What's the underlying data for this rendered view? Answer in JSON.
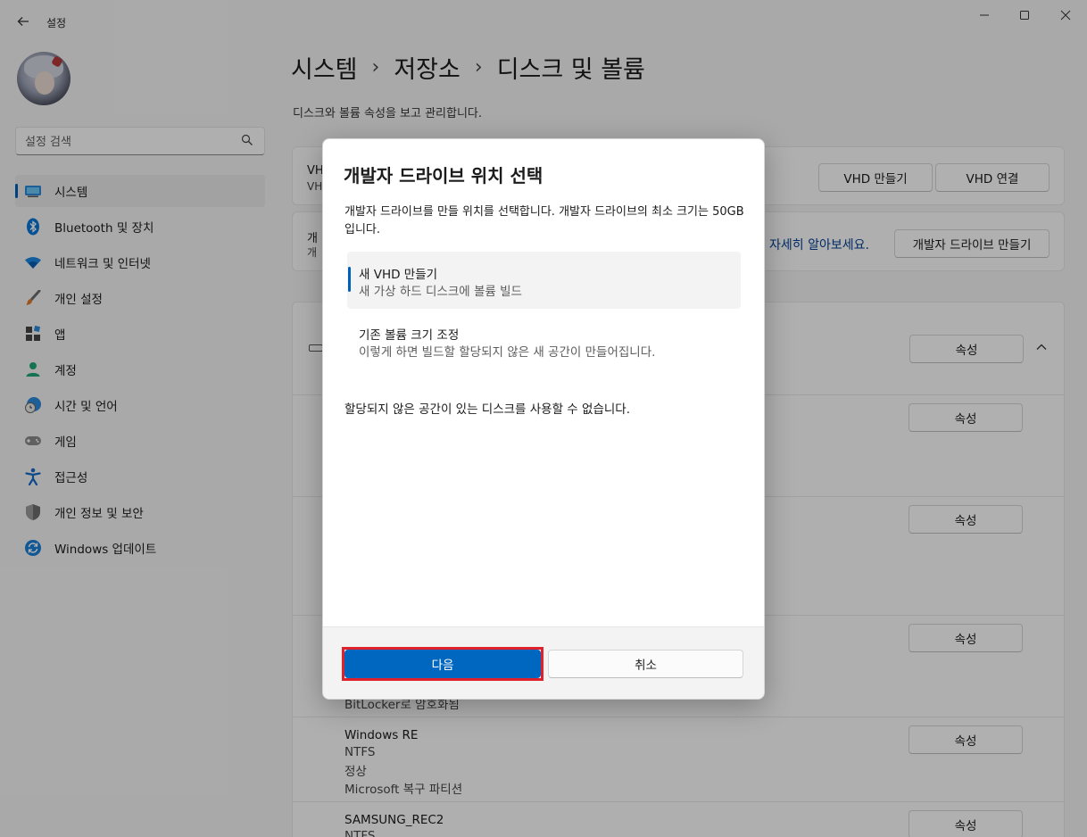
{
  "window": {
    "app_title": "설정",
    "controls": {
      "minimize": "minimize-icon",
      "maximize": "maximize-icon",
      "close": "close-icon"
    }
  },
  "sidebar": {
    "search_placeholder": "설정 검색",
    "items": [
      {
        "label": "시스템",
        "icon": "system-icon",
        "active": true
      },
      {
        "label": "Bluetooth 및 장치",
        "icon": "bluetooth-icon"
      },
      {
        "label": "네트워크 및 인터넷",
        "icon": "wifi-icon"
      },
      {
        "label": "개인 설정",
        "icon": "brush-icon"
      },
      {
        "label": "앱",
        "icon": "apps-icon"
      },
      {
        "label": "계정",
        "icon": "account-icon"
      },
      {
        "label": "시간 및 언어",
        "icon": "clock-globe-icon"
      },
      {
        "label": "게임",
        "icon": "gamepad-icon"
      },
      {
        "label": "접근성",
        "icon": "accessibility-icon"
      },
      {
        "label": "개인 정보 및 보안",
        "icon": "shield-icon"
      },
      {
        "label": "Windows 업데이트",
        "icon": "update-icon"
      }
    ]
  },
  "main": {
    "breadcrumb": [
      "시스템",
      "저장소",
      "디스크 및 볼륨"
    ],
    "description": "디스크와 볼륨 속성을 보고 관리합니다.",
    "vhd_card": {
      "partial_label": "VH",
      "partial_sub": "VH",
      "create_vhd": "VHD 만들기",
      "attach_vhd": "VHD 연결"
    },
    "devdrive_card": {
      "partial_label": "개",
      "partial_sub": "개",
      "learn_more": "자세히 알아보세요.",
      "create_button": "개발자 드라이브 만들기"
    },
    "properties_label": "속성",
    "volumes": [
      {
        "partial": "BitLocker로 암호화됨"
      },
      {
        "name": "Windows RE",
        "fs": "NTFS",
        "status": "정상",
        "type": "Microsoft 복구 파티션"
      },
      {
        "name": "SAMSUNG_REC2",
        "fs": "NTFS"
      }
    ]
  },
  "dialog": {
    "title": "개발자 드라이브 위치 선택",
    "description": "개발자 드라이브를 만들 위치를 선택합니다. 개발자 드라이브의 최소 크기는 50GB입니다.",
    "options": [
      {
        "title": "새 VHD 만들기",
        "subtitle": "새 가상 하드 디스크에 볼륨 빌드",
        "selected": true
      },
      {
        "title": "기존 볼륨 크기 조정",
        "subtitle": "이렇게 하면 빌드할 할당되지 않은 새 공간이 만들어집니다."
      }
    ],
    "warning": "할당되지 않은 공간이 있는 디스크를 사용할 수 없습니다.",
    "primary_button": "다음",
    "secondary_button": "취소",
    "accent_color": "#0067c0",
    "highlight_color": "#e0202a"
  }
}
